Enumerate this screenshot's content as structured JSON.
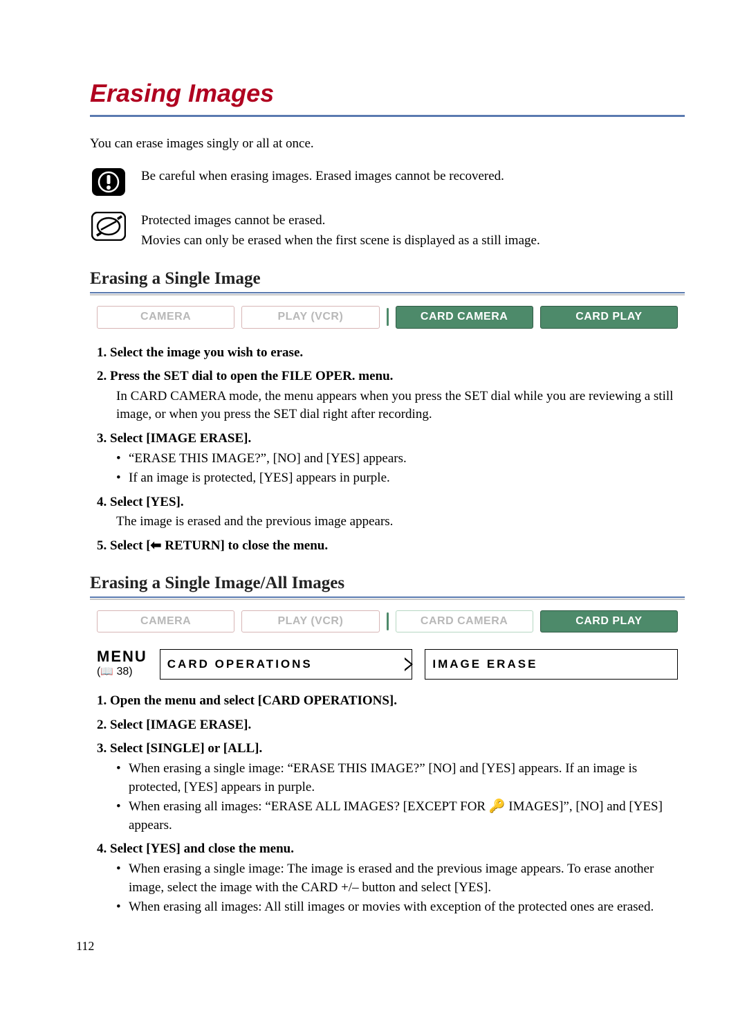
{
  "title": "Erasing Images",
  "intro": "You can erase images singly or all at once.",
  "warning": {
    "line1": "Be careful when erasing images. Erased images cannot be recovered."
  },
  "note": {
    "line1": "Protected images cannot be erased.",
    "line2": "Movies can only be erased when the first scene is displayed as a still image."
  },
  "section1": {
    "heading": "Erasing a Single Image",
    "modes": {
      "camera": "CAMERA",
      "play": "PLAY (VCR)",
      "cardcam": "CARD CAMERA",
      "cardplay": "CARD PLAY"
    },
    "steps": {
      "s1": "1. Select the image you wish to erase.",
      "s2": "2. Press the SET dial to open the FILE OPER. menu.",
      "s2body": "In CARD CAMERA mode, the menu appears when you press the SET dial while you are reviewing a still image, or when you press the SET dial right after recording.",
      "s3": "3. Select [IMAGE ERASE].",
      "s3li1": "“ERASE THIS IMAGE?”, [NO] and [YES] appears.",
      "s3li2": "If an image is protected, [YES] appears in purple.",
      "s4": "4. Select [YES].",
      "s4body": "The image is erased and the previous image appears.",
      "s5": "5. Select [⬅ RETURN] to close the menu."
    }
  },
  "section2": {
    "heading": "Erasing a Single Image/All Images",
    "modes": {
      "camera": "CAMERA",
      "play": "PLAY (VCR)",
      "cardcam": "CARD CAMERA",
      "cardplay": "CARD PLAY"
    },
    "menu": {
      "label": "MENU",
      "ref": "38",
      "cell1": "CARD OPERATIONS",
      "cell2": "IMAGE ERASE"
    },
    "steps": {
      "s1": "1. Open the menu and select [CARD OPERATIONS].",
      "s2": "2. Select [IMAGE ERASE].",
      "s3": "3. Select [SINGLE] or [ALL].",
      "s3li1": "When erasing a single image: “ERASE THIS IMAGE?” [NO] and [YES] appears. If an image is protected, [YES] appears in purple.",
      "s3li2": "When erasing all images: “ERASE ALL IMAGES? [EXCEPT FOR 🔑 IMAGES]”, [NO] and [YES] appears.",
      "s4": "4. Select [YES] and close the menu.",
      "s4li1": "When erasing a single image: The image is erased and the previous image appears. To erase another image, select the image with the CARD +/– button and select [YES].",
      "s4li2": "When erasing all images: All still images or movies with exception of the protected ones are erased."
    }
  },
  "pageNumber": "112"
}
